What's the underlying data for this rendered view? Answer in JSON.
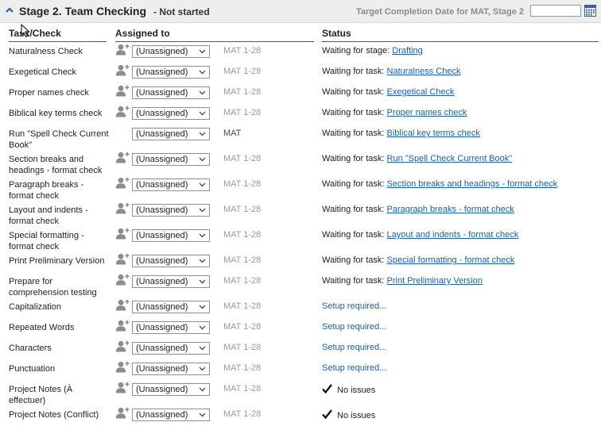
{
  "header": {
    "title": "Stage 2. Team Checking",
    "status": "- Not started",
    "target_label": "Target Completion Date for MAT, Stage 2",
    "date_value": ""
  },
  "columns": {
    "task": "Task/Check",
    "assigned": "Assigned to",
    "status": "Status"
  },
  "rows": [
    {
      "task": "Naturalness Check",
      "assignee": "(Unassigned)",
      "chapters": "MAT 1-28",
      "status_prefix": "Waiting for stage: ",
      "status_link": "Drafting"
    },
    {
      "task": "Exegetical Check",
      "assignee": "(Unassigned)",
      "chapters": "MAT 1-28",
      "status_prefix": "Waiting for task: ",
      "status_link": "Naturalness Check"
    },
    {
      "task": "Proper names check",
      "assignee": "(Unassigned)",
      "chapters": "MAT 1-28",
      "status_prefix": "Waiting for task: ",
      "status_link": "Exegetical Check"
    },
    {
      "task": "Biblical key terms check",
      "assignee": "(Unassigned)",
      "chapters": "MAT 1-28",
      "status_prefix": "Waiting for task: ",
      "status_link": "Proper names check"
    },
    {
      "task": "Run \"Spell Check Current Book\"",
      "assignee": "(Unassigned)",
      "chapters": "MAT",
      "status_prefix": "Waiting for task: ",
      "status_link": "Biblical key terms check"
    },
    {
      "task": "Section breaks and headings - format check",
      "assignee": "(Unassigned)",
      "chapters": "MAT 1-28",
      "status_prefix": "Waiting for task: ",
      "status_link": "Run \"Spell Check Current Book\""
    },
    {
      "task": "Paragraph breaks - format check",
      "assignee": "(Unassigned)",
      "chapters": "MAT 1-28",
      "status_prefix": "Waiting for task: ",
      "status_link": "Section breaks and headings - format check"
    },
    {
      "task": "Layout and indents - format check",
      "assignee": "(Unassigned)",
      "chapters": "MAT 1-28",
      "status_prefix": "Waiting for task: ",
      "status_link": "Paragraph breaks - format check"
    },
    {
      "task": "Special formatting - format check",
      "assignee": "(Unassigned)",
      "chapters": "MAT 1-28",
      "status_prefix": "Waiting for task: ",
      "status_link": "Layout and indents - format check"
    },
    {
      "task": "Print Preliminary Version",
      "assignee": "(Unassigned)",
      "chapters": "MAT 1-28",
      "status_prefix": "Waiting for task: ",
      "status_link": "Special formatting - format check"
    },
    {
      "task": "Prepare for comprehension testing",
      "assignee": "(Unassigned)",
      "chapters": "MAT 1-28",
      "status_prefix": "Waiting for task: ",
      "status_link": "Print Preliminary Version"
    },
    {
      "task": "Capitalization",
      "assignee": "(Unassigned)",
      "chapters": "MAT 1-28",
      "status_setup": "Setup required..."
    },
    {
      "task": "Repeated Words",
      "assignee": "(Unassigned)",
      "chapters": "MAT 1-28",
      "status_setup": "Setup required..."
    },
    {
      "task": "Characters",
      "assignee": "(Unassigned)",
      "chapters": "MAT 1-28",
      "status_setup": "Setup required..."
    },
    {
      "task": "Punctuation",
      "assignee": "(Unassigned)",
      "chapters": "MAT 1-28",
      "status_setup": "Setup required..."
    },
    {
      "task": "Project Notes (À effectuer)",
      "assignee": "(Unassigned)",
      "chapters": "MAT 1-28",
      "status_ok": "No issues"
    },
    {
      "task": "Project Notes (Conflict)",
      "assignee": "(Unassigned)",
      "chapters": "MAT 1-28",
      "status_ok": "No issues"
    }
  ],
  "colors": {
    "link": "#1a5db5",
    "header_bg": "#eeeeee",
    "muted": "#9a9a9a"
  }
}
